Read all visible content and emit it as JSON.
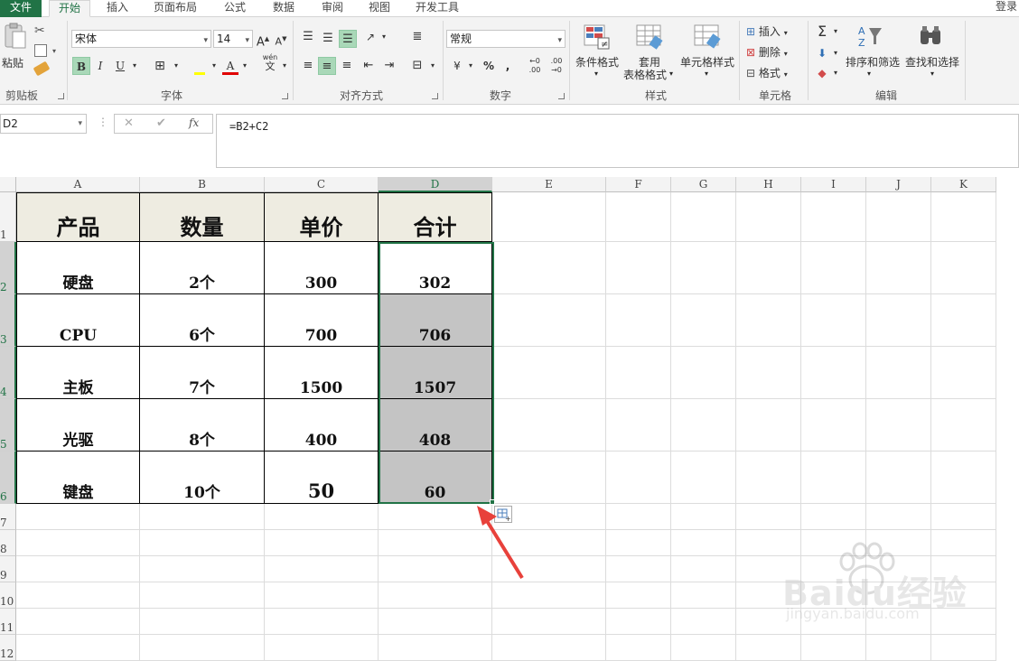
{
  "tabs": [
    "文件",
    "开始",
    "插入",
    "页面布局",
    "公式",
    "数据",
    "审阅",
    "视图",
    "开发工具"
  ],
  "login": "登录",
  "ribbon": {
    "clipboard": {
      "paste": "粘贴",
      "label": "剪贴板"
    },
    "font": {
      "name": "宋体",
      "size": "14",
      "bold": "B",
      "italic": "I",
      "underline": "U",
      "font_color": "A",
      "wen": "wén",
      "label": "字体"
    },
    "align": {
      "label": "对齐方式"
    },
    "number": {
      "format": "常规",
      "percent": "%",
      "comma": ",",
      "label": "数字"
    },
    "styles": {
      "cond": "条件格式",
      "table1": "套用",
      "table2": "表格格式",
      "cell_style": "单元格样式",
      "label": "样式"
    },
    "cells": {
      "insert": "插入",
      "delete": "删除",
      "format": "格式",
      "label": "单元格"
    },
    "editing": {
      "sort": "排序和筛选",
      "find": "查找和选择",
      "label": "编辑"
    }
  },
  "formula_bar": {
    "name_box": "D2",
    "formula": "=B2+C2",
    "fx": "fx"
  },
  "columns": [
    "A",
    "B",
    "C",
    "D",
    "E",
    "F",
    "G",
    "H",
    "I",
    "J",
    "K"
  ],
  "rows": [
    "1",
    "2",
    "3",
    "4",
    "5",
    "6",
    "7",
    "8",
    "9",
    "10",
    "11",
    "12"
  ],
  "table": {
    "headers": [
      "产品",
      "数量",
      "单价",
      "合计"
    ],
    "rows": [
      [
        "硬盘",
        "2个",
        "300",
        "302"
      ],
      [
        "CPU",
        "6个",
        "700",
        "706"
      ],
      [
        "主板",
        "7个",
        "1500",
        "1507"
      ],
      [
        "光驱",
        "8个",
        "400",
        "408"
      ],
      [
        "键盘",
        "10个",
        "50",
        "60"
      ]
    ]
  },
  "watermark": {
    "text": "Baidu经验",
    "url": "jingyan.baidu.com"
  },
  "colors": {
    "accent": "#217346",
    "header_fill": "#eeece1",
    "selection_gray": "#c4c4c4",
    "arrow": "#e8413b"
  }
}
